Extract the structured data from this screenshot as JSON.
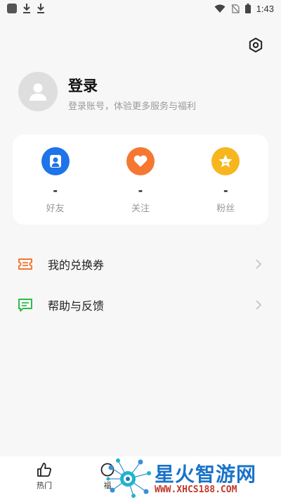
{
  "status_bar": {
    "time": "1:43"
  },
  "profile": {
    "title": "登录",
    "subtitle": "登录账号，体验更多服务与福利"
  },
  "stats": [
    {
      "count": "-",
      "label": "好友",
      "color": "#1e74e8",
      "icon": "user-icon"
    },
    {
      "count": "-",
      "label": "关注",
      "color": "#f57832",
      "icon": "heart-icon"
    },
    {
      "count": "-",
      "label": "粉丝",
      "color": "#f7b51e",
      "icon": "star-icon"
    }
  ],
  "menu": [
    {
      "label": "我的兑换券",
      "icon": "ticket-icon",
      "color": "#f57832"
    },
    {
      "label": "帮助与反馈",
      "icon": "feedback-icon",
      "color": "#2dbd4c"
    }
  ],
  "bottom_nav": [
    {
      "label": "热门",
      "icon": "thumbs-up-icon"
    },
    {
      "label": "福",
      "icon": "gift-icon"
    }
  ],
  "watermark": {
    "title": "星火智游网",
    "url": "WWW.XHCS188.COM"
  }
}
